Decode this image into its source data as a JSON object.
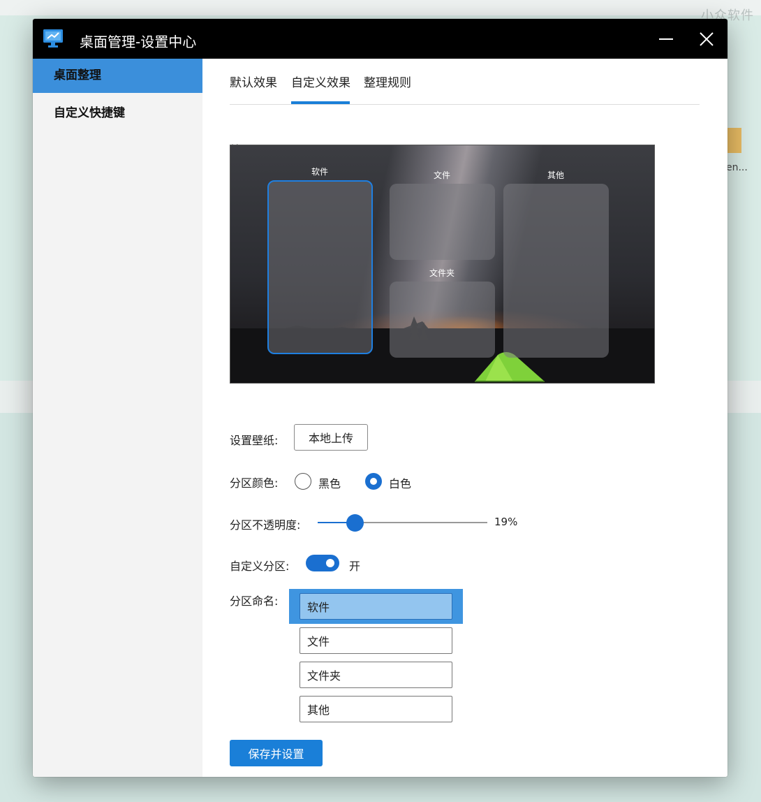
{
  "watermark": "小众软件",
  "desktop": {
    "folder_label": "en..."
  },
  "window": {
    "title": "桌面管理-设置中心"
  },
  "sidebar": {
    "items": [
      {
        "label": "桌面整理",
        "active": true
      },
      {
        "label": "自定义快捷键",
        "active": false
      }
    ]
  },
  "tabs": [
    {
      "label": "默认效果",
      "active": false
    },
    {
      "label": "自定义效果",
      "active": true
    },
    {
      "label": "整理规则",
      "active": false
    }
  ],
  "preview": {
    "label": "效果图",
    "zones": [
      {
        "label": "软件",
        "selected": true
      },
      {
        "label": "文件",
        "selected": false
      },
      {
        "label": "文件夹",
        "selected": false
      },
      {
        "label": "其他",
        "selected": false
      }
    ]
  },
  "wallpaper": {
    "label": "设置壁纸:",
    "button": "本地上传"
  },
  "zone_color": {
    "label": "分区颜色:",
    "options": [
      {
        "label": "黑色",
        "selected": false
      },
      {
        "label": "白色",
        "selected": true
      }
    ]
  },
  "opacity": {
    "label": "分区不透明度:",
    "value_text": "19%",
    "value": 0.19
  },
  "custom_zone": {
    "label": "自定义分区:",
    "state": "开",
    "on": true
  },
  "zone_names": {
    "label": "分区命名:",
    "values": [
      "软件",
      "文件",
      "文件夹",
      "其他"
    ]
  },
  "save_button": "保存并设置",
  "colors": {
    "accent": "#1a7fd8",
    "sidebar_active": "#3b8fdb",
    "titlebar": "#000000"
  }
}
